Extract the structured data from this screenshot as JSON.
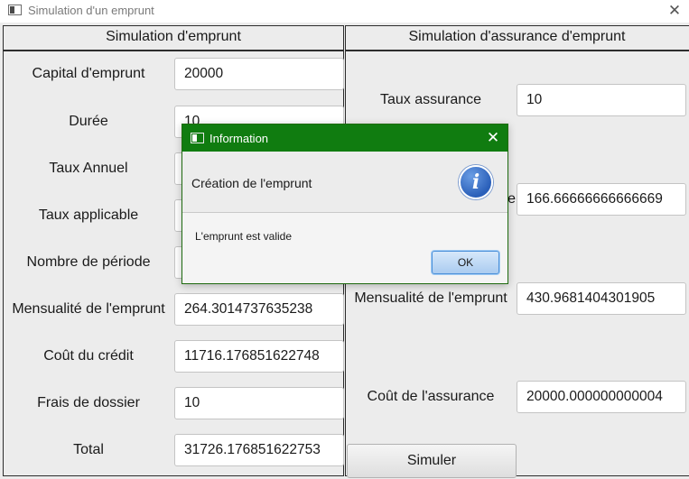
{
  "window": {
    "title": "Simulation d'un emprunt",
    "close_glyph": "✕"
  },
  "left_panel": {
    "header": "Simulation d'emprunt",
    "rows": [
      {
        "label": "Capital d'emprunt",
        "value": "20000"
      },
      {
        "label": "Durée",
        "value": "10"
      },
      {
        "label": "Taux Annuel",
        "value": ""
      },
      {
        "label": "Taux applicable",
        "value": ""
      },
      {
        "label": "Nombre de période",
        "value": ""
      },
      {
        "label": "Mensualité de l'emprunt",
        "value": "264.3014737635238"
      },
      {
        "label": "Coût du crédit",
        "value": "11716.176851622748"
      },
      {
        "label": "Frais de dossier",
        "value": "10"
      },
      {
        "label": "Total",
        "value": "31726.176851622753"
      }
    ]
  },
  "right_panel": {
    "header": "Simulation d'assurance d'emprunt",
    "rows": [
      {
        "label": "Taux assurance",
        "value": "10"
      },
      {
        "label": "e",
        "value": "166.66666666666669"
      },
      {
        "label": "Mensualité de l'emprunt",
        "value": "430.9681404301905"
      },
      {
        "label": "Coût de l'assurance",
        "value": "20000.000000000004"
      }
    ],
    "button_label": "Simuler"
  },
  "dialog": {
    "title": "Information",
    "close_glyph": "✕",
    "header_text": "Création de l'emprunt",
    "icon_glyph": "i",
    "content_text": "L'emprunt est valide",
    "ok_label": "OK"
  },
  "colors": {
    "dialog_titlebar": "#107c10",
    "info_icon": "#2a5fb9",
    "ok_button": "#aacbf0"
  }
}
